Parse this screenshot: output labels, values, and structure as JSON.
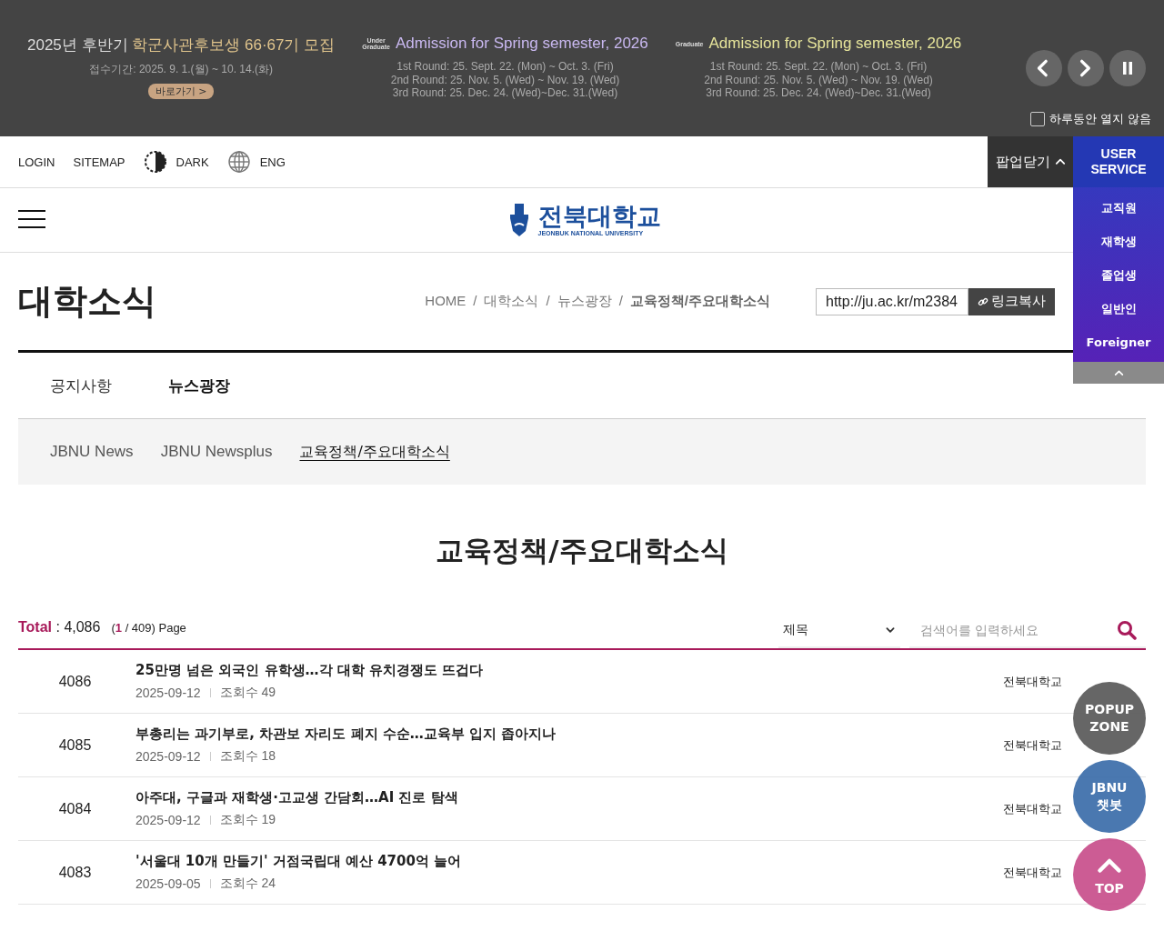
{
  "banner": {
    "promos": [
      {
        "kind": "rotc",
        "title_prefix": "2025년 후반기",
        "title_highlight": "학군사관후보생 66·67기 모집",
        "lines": [
          "접수기간: 2025. 9. 1.(월) ~ 10. 14.(화)"
        ],
        "link": "바로가기 >"
      },
      {
        "kind": "admission",
        "tag": [
          "Under",
          "Graduate"
        ],
        "title": "Admission for Spring semester, 2026",
        "color": "#c9b8f0",
        "lines": [
          "1st Round: 25. Sept. 22. (Mon) ~ Oct. 3. (Fri)",
          "2nd Round: 25. Nov. 5. (Wed) ~ Nov. 19. (Wed)",
          "3rd Round: 25. Dec. 24. (Wed)~Dec. 31.(Wed)"
        ]
      },
      {
        "kind": "admission",
        "tag": [
          "Graduate"
        ],
        "title": "Admission for Spring semester, 2026",
        "color": "#e6e49a",
        "lines": [
          "1st Round: 25. Sept. 22. (Mon) ~ Oct. 3. (Fri)",
          "2nd Round: 25. Nov. 5. (Wed) ~ Nov. 19. (Wed)",
          "3rd Round: 25. Dec. 24. (Wed)~Dec. 31.(Wed)"
        ]
      }
    ],
    "dont_show": {
      "label": "하루동안 열지 않음",
      "checked": false
    }
  },
  "utility": [
    "LOGIN",
    "SITEMAP",
    "DARK",
    "ENG"
  ],
  "popup_close": "팝업닫기",
  "user_service": {
    "title": [
      "USER",
      "SERVICE"
    ],
    "items": [
      "교직원",
      "재학생",
      "졸업생",
      "일반인",
      "Foreigner"
    ]
  },
  "logo": {
    "name": "전북대학교",
    "subtitle": "JEONBUK NATIONAL UNIVERSITY"
  },
  "page_title": "대학소식",
  "breadcrumb": [
    "HOME",
    "대학소식",
    "뉴스광장",
    "교육정책/주요대학소식"
  ],
  "breadcrumb_separator": "/",
  "url": "http://ju.ac.kr/m2384",
  "copy_button": "링크복사",
  "tabs": [
    {
      "label": "공지사항",
      "selected": false
    },
    {
      "label": "뉴스광장",
      "selected": true
    }
  ],
  "subtabs": [
    {
      "label": "JBNU News",
      "selected": false
    },
    {
      "label": "JBNU Newsplus",
      "selected": false
    },
    {
      "label": "교육정책/주요대학소식",
      "selected": true
    }
  ],
  "heading": "교육정책/주요대학소식",
  "summary": {
    "total_label": "Total",
    "total": ": 4,086",
    "page_open": "(",
    "page": "1",
    "pages": "/ 409) Page"
  },
  "search": {
    "field": "제목",
    "placeholder": "검색어를 입력하세요"
  },
  "rows": [
    {
      "no": "4086",
      "title": "25만명 넘은 외국인 유학생…각 대학 유치경쟁도 뜨겁다",
      "date": "2025-09-12",
      "views": "조회수 49",
      "author": "전북대학교"
    },
    {
      "no": "4085",
      "title": "부총리는 과기부로, 차관보 자리도 폐지 수순…교육부 입지 좁아지나",
      "date": "2025-09-12",
      "views": "조회수 18",
      "author": "전북대학교"
    },
    {
      "no": "4084",
      "title": "아주대, 구글과 재학생·고교생 간담회…AI 진로 탐색",
      "date": "2025-09-12",
      "views": "조회수 19",
      "author": "전북대학교"
    },
    {
      "no": "4083",
      "title": "'서울대 10개 만들기' 거점국립대 예산 4700억 늘어",
      "date": "2025-09-05",
      "views": "조회수 24",
      "author": "전북대학교"
    }
  ],
  "floating": [
    {
      "kind": "popup",
      "label": [
        "POPUP",
        "ZONE"
      ]
    },
    {
      "kind": "chatbot",
      "label": [
        "JBNU",
        "챗봇"
      ]
    },
    {
      "kind": "top",
      "label": [
        "TOP"
      ]
    }
  ]
}
